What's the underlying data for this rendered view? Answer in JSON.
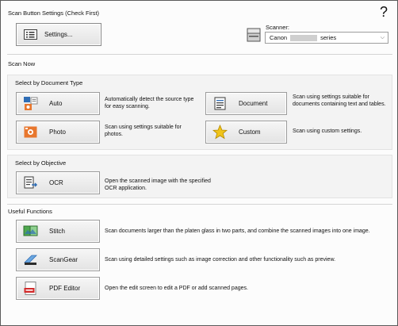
{
  "scan_button_settings": {
    "heading": "Scan Button Settings (Check First)",
    "settings_button": "Settings..."
  },
  "scanner": {
    "label": "Scanner:",
    "selected_prefix": "Canon",
    "selected_suffix": "series"
  },
  "scan_now": {
    "heading": "Scan Now"
  },
  "document_type": {
    "heading": "Select by Document Type",
    "items": [
      {
        "label": "Auto",
        "description": "Automatically detect the source type for easy scanning.",
        "icon": "auto-scan-icon"
      },
      {
        "label": "Document",
        "description": "Scan using settings suitable for documents containing text and tables.",
        "icon": "document-icon"
      },
      {
        "label": "Photo",
        "description": "Scan using settings suitable for photos.",
        "icon": "photo-icon"
      },
      {
        "label": "Custom",
        "description": "Scan using custom settings.",
        "icon": "star-icon"
      }
    ]
  },
  "objective": {
    "heading": "Select by Objective",
    "items": [
      {
        "label": "OCR",
        "description": "Open the scanned image with the specified OCR application.",
        "icon": "ocr-icon"
      }
    ]
  },
  "useful_functions": {
    "heading": "Useful Functions",
    "items": [
      {
        "label": "Stitch",
        "description": "Scan documents larger than the platen glass in two parts, and combine the scanned images into one image.",
        "icon": "stitch-icon"
      },
      {
        "label": "ScanGear",
        "description": "Scan using detailed settings such as image correction and other functionality such as preview.",
        "icon": "scangear-icon"
      },
      {
        "label": "PDF Editor",
        "description": "Open the edit screen to edit a PDF or add scanned pages.",
        "icon": "pdf-icon"
      }
    ]
  },
  "help": {
    "glyph": "?"
  },
  "colors": {
    "window_border": "#5a5a5a",
    "panel_bg": "#f3f3f3",
    "button_bg": "#e8e8e8",
    "icon_blue": "#2f6db5",
    "icon_orange": "#e8772e",
    "star_yellow": "#f0c419",
    "pdf_red": "#d22b2b"
  }
}
